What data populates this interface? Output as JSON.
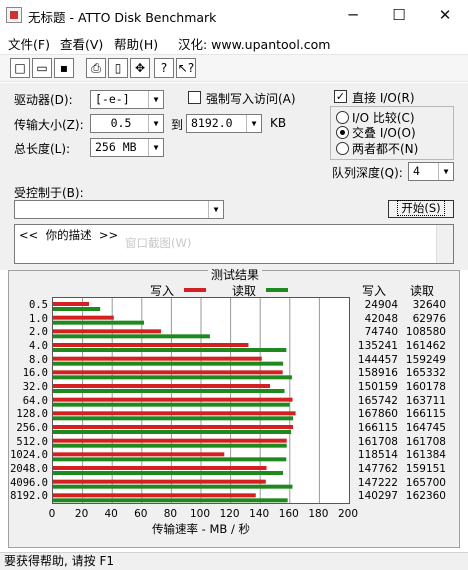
{
  "window": {
    "title": "无标题 - ATTO Disk Benchmark",
    "minimize": "─",
    "maximize": "☐",
    "close": "✕"
  },
  "menu": {
    "file": "文件(F)",
    "view": "查看(V)",
    "help": "帮助(H)",
    "localization": "汉化: www.upantool.com"
  },
  "toolbar": {
    "icons": [
      "new-icon",
      "open-icon",
      "save-icon",
      "print-icon",
      "print-preview-icon",
      "move-icon",
      "help-icon",
      "context-help-icon"
    ]
  },
  "settings": {
    "drive_label": "驱动器(D):",
    "drive_value": "[-e-]",
    "force_write_label": "强制写入访问(A)",
    "transfer_size_label": "传输大小(Z):",
    "transfer_from": "0.5",
    "transfer_to_label": "到",
    "transfer_to": "8192.0",
    "transfer_unit": "KB",
    "total_length_label": "总长度(L):",
    "total_length_value": "256 MB",
    "direct_io_label": "直接 I/O(R)",
    "io_compare_label": "I/O 比较(C)",
    "overlapped_io_label": "交叠 I/O(O)",
    "neither_label": "两者都不(N)",
    "queue_depth_label": "队列深度(Q):",
    "queue_depth_value": "4",
    "controlled_by_label": "受控制于(B):",
    "controlled_by_value": "",
    "start_button": "开始(S)",
    "description_text": "<<  你的描述  >>",
    "ghost_text": "窗口截图(W)"
  },
  "results": {
    "group_title": "测试结果",
    "legend_write": "写入",
    "legend_read": "读取",
    "col_write": "写入",
    "col_read": "读取",
    "xlabel": "传输速率 - MB / 秒"
  },
  "chart_data": {
    "type": "bar",
    "orientation": "horizontal",
    "categories": [
      "0.5",
      "1.0",
      "2.0",
      "4.0",
      "8.0",
      "16.0",
      "32.0",
      "64.0",
      "128.0",
      "256.0",
      "512.0",
      "1024.0",
      "2048.0",
      "4096.0",
      "8192.0"
    ],
    "series": [
      {
        "name": "写入",
        "values": [
          24904,
          42048,
          74740,
          135241,
          144457,
          158916,
          150159,
          165742,
          167860,
          166115,
          161708,
          118514,
          147762,
          147222,
          140297
        ]
      },
      {
        "name": "读取",
        "values": [
          32640,
          62976,
          108580,
          161462,
          159249,
          165332,
          160178,
          163711,
          166115,
          164745,
          161708,
          161384,
          159151,
          165700,
          162360
        ]
      }
    ],
    "xticks": [
      "0",
      "20",
      "40",
      "60",
      "80",
      "100",
      "120",
      "140",
      "160",
      "180",
      "200"
    ],
    "xlim": [
      0,
      200
    ],
    "xlabel": "传输速率 - MB / 秒",
    "colors": {
      "write": "#d42020",
      "read": "#1e8a1e"
    },
    "grid": true
  },
  "status": {
    "text": "要获得帮助, 请按 F1"
  }
}
